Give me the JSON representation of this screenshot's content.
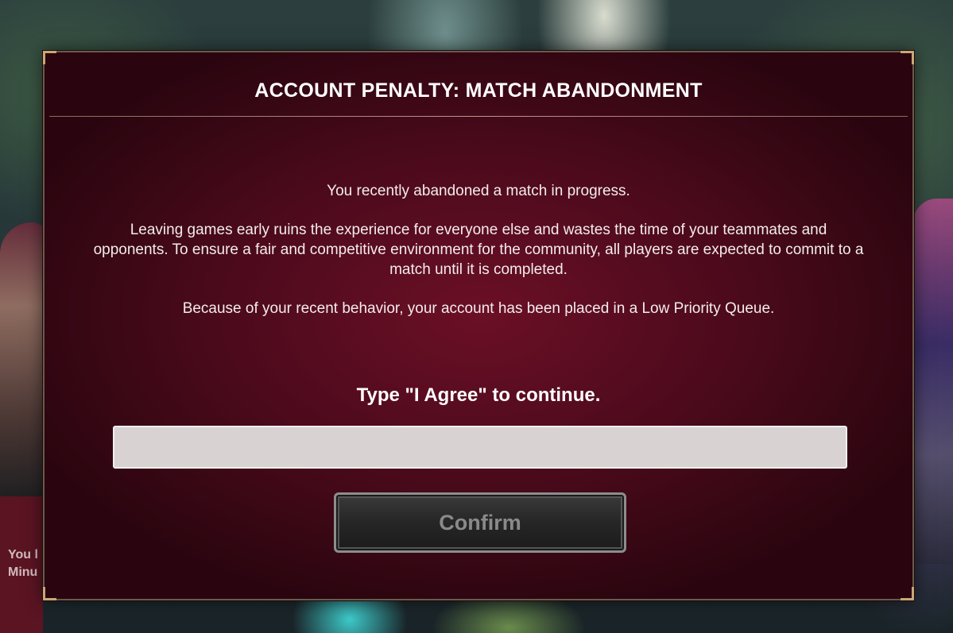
{
  "background": {
    "partial_text_line1": "You l",
    "partial_text_line2": "Minu"
  },
  "dialog": {
    "title": "ACCOUNT PENALTY: MATCH ABANDONMENT",
    "paragraphs": [
      "You recently abandoned a match in progress.",
      "Leaving games early ruins the experience for everyone else and wastes the time of your teammates and opponents. To ensure a fair and competitive environment for the community, all players are expected to commit to a match until it is completed.",
      "Because of your recent behavior, your account has been placed in a Low Priority Queue."
    ],
    "prompt": "Type \"I Agree\" to continue.",
    "input": {
      "value": "",
      "placeholder": ""
    },
    "confirm_label": "Confirm"
  },
  "colors": {
    "dialog_bg": "#4a0a1b",
    "dialog_center": "#6b0f26",
    "frame_gold": "#c9a774",
    "input_bg": "#d9d2d3",
    "button_text_disabled": "#8a8a8a"
  }
}
